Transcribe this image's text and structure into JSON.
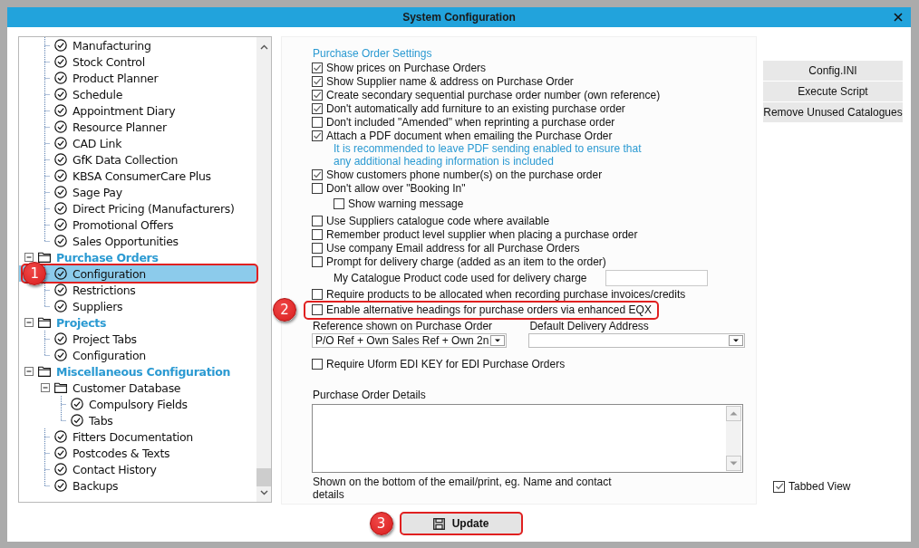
{
  "window": {
    "title": "System Configuration"
  },
  "tree": {
    "items": [
      {
        "children": [
          {
            "kind": "item",
            "label": "Manufacturing",
            "selected": false
          },
          {
            "kind": "item",
            "label": "Stock Control",
            "selected": false
          },
          {
            "kind": "item",
            "label": "Product Planner",
            "selected": false
          },
          {
            "kind": "item",
            "label": "Schedule",
            "selected": false
          },
          {
            "kind": "item",
            "label": "Appointment Diary",
            "selected": false
          },
          {
            "kind": "item",
            "label": "Resource Planner",
            "selected": false
          },
          {
            "kind": "item",
            "label": "CAD Link",
            "selected": false
          },
          {
            "kind": "item",
            "label": "GfK Data Collection",
            "selected": false
          },
          {
            "kind": "item",
            "label": "KBSA ConsumerCare Plus",
            "selected": false
          },
          {
            "kind": "item",
            "label": "Sage Pay",
            "selected": false
          },
          {
            "kind": "item",
            "label": "Direct Pricing (Manufacturers)",
            "selected": false
          },
          {
            "kind": "item",
            "label": "Promotional Offers",
            "selected": false
          },
          {
            "kind": "item",
            "label": "Sales Opportunities",
            "selected": false
          }
        ]
      },
      {
        "kind": "group",
        "label": "Purchase Orders",
        "selected": false,
        "expanded": true,
        "children": [
          {
            "kind": "item",
            "label": "Configuration",
            "selected": true,
            "callout": "1"
          },
          {
            "kind": "item",
            "label": "Restrictions",
            "selected": false
          },
          {
            "kind": "item",
            "label": "Suppliers",
            "selected": false
          }
        ]
      },
      {
        "kind": "group",
        "label": "Projects",
        "selected": false,
        "expanded": true,
        "children": [
          {
            "kind": "item",
            "label": "Project Tabs",
            "selected": false
          },
          {
            "kind": "item",
            "label": "Configuration",
            "selected": false
          }
        ]
      },
      {
        "kind": "group",
        "label": "Miscellaneous Configuration",
        "selected": false,
        "expanded": true,
        "children": [
          {
            "kind": "folder",
            "label": "Customer Database",
            "selected": false,
            "expanded": true,
            "children": [
              {
                "kind": "item",
                "label": "Compulsory Fields",
                "selected": false
              },
              {
                "kind": "item",
                "label": "Tabs",
                "selected": false
              }
            ]
          },
          {
            "kind": "item",
            "label": "Fitters Documentation",
            "selected": false
          },
          {
            "kind": "item",
            "label": "Postcodes & Texts",
            "selected": false
          },
          {
            "kind": "item",
            "label": "Contact History",
            "selected": false
          },
          {
            "kind": "item",
            "label": "Backups",
            "selected": false
          }
        ]
      }
    ]
  },
  "settings": {
    "title": "Purchase Order Settings",
    "items": [
      {
        "kind": "checkbox",
        "label": "Show prices on Purchase Orders",
        "checked": true
      },
      {
        "kind": "checkbox",
        "label": "Show Supplier name & address on Purchase Order",
        "checked": true
      },
      {
        "kind": "checkbox",
        "label": "Create secondary sequential purchase order number (own reference)",
        "checked": true
      },
      {
        "kind": "checkbox",
        "label": "Don't automatically add furniture to an existing purchase order",
        "checked": true
      },
      {
        "kind": "checkbox",
        "label": "Don't included \"Amended\" when reprinting a purchase order",
        "checked": false
      },
      {
        "kind": "checkbox",
        "label": "Attach a PDF document when emailing the Purchase Order",
        "checked": true
      },
      {
        "kind": "note",
        "text": "It is recommended to leave PDF sending enabled to ensure that any additional heading information is included"
      },
      {
        "kind": "checkbox",
        "label": "Show customers phone number(s) on the purchase order",
        "checked": true
      },
      {
        "kind": "checkbox",
        "label": "Don't allow over \"Booking In\"",
        "checked": false,
        "children": [
          {
            "kind": "checkbox",
            "label": "Show warning message",
            "checked": false
          }
        ]
      },
      {
        "kind": "checkbox",
        "label": "Use Suppliers catalogue code where available",
        "checked": false
      },
      {
        "kind": "checkbox",
        "label": "Remember product level supplier when placing a purchase order",
        "checked": false
      },
      {
        "kind": "checkbox",
        "label": "Use company Email address for all Purchase Orders",
        "checked": false
      },
      {
        "kind": "checkbox",
        "label": "Prompt for delivery charge (added as an item to the order)",
        "checked": false
      },
      {
        "kind": "field",
        "label": "My Catalogue Product code used for delivery charge"
      },
      {
        "kind": "checkbox",
        "label": "Require products to be allocated when recording purchase invoices/credits",
        "checked": false
      },
      {
        "kind": "checkbox",
        "label": "Enable alternative headings for purchase orders via enhanced EQX",
        "checked": false,
        "callout": "2"
      }
    ],
    "selects": [
      {
        "label": "Reference shown on Purchase Order",
        "value": "P/O Ref + Own Sales Ref + Own 2n"
      },
      {
        "label": "Default Delivery Address"
      }
    ],
    "more_items": [
      {
        "kind": "checkbox",
        "label": "Require Uform EDI KEY for EDI Purchase Orders",
        "checked": false
      }
    ],
    "details": {
      "label": "Purchase Order Details",
      "hint": "Shown on the bottom of the email/print, eg. Name and contact details"
    }
  },
  "side": {
    "buttons": [
      "Config.INI",
      "Execute Script",
      "Remove Unused Catalogues"
    ],
    "tabbed_view": {
      "label": "Tabbed View",
      "checked": true
    }
  },
  "update_button": {
    "label": "Update",
    "callout": "3"
  }
}
